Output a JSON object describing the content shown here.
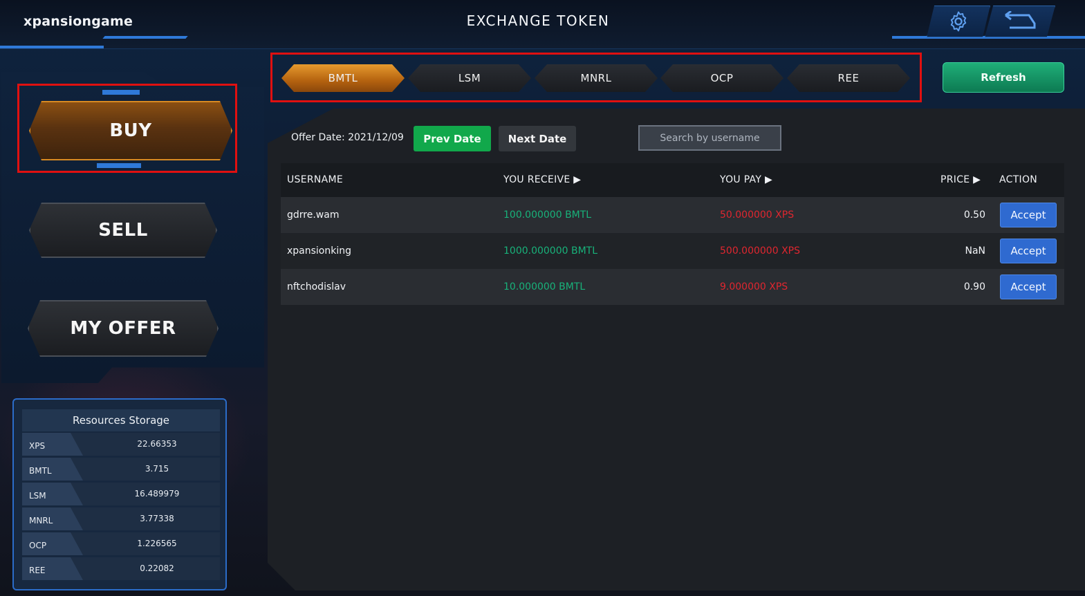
{
  "header": {
    "brand": "xpansiongame",
    "title": "EXCHANGE TOKEN",
    "settings_icon": "gear-icon",
    "back_icon": "back-arrow-icon"
  },
  "sidebar": {
    "buy_label": "BUY",
    "sell_label": "SELL",
    "my_offer_label": "MY OFFER"
  },
  "storage": {
    "title": "Resources Storage",
    "items": [
      {
        "name": "XPS",
        "value": "22.66353"
      },
      {
        "name": "BMTL",
        "value": "3.715"
      },
      {
        "name": "LSM",
        "value": "16.489979"
      },
      {
        "name": "MNRL",
        "value": "3.77338"
      },
      {
        "name": "OCP",
        "value": "1.226565"
      },
      {
        "name": "REE",
        "value": "0.22082"
      }
    ]
  },
  "tabs": [
    {
      "label": "BMTL",
      "active": true
    },
    {
      "label": "LSM",
      "active": false
    },
    {
      "label": "MNRL",
      "active": false
    },
    {
      "label": "OCP",
      "active": false
    },
    {
      "label": "REE",
      "active": false
    }
  ],
  "refresh_label": "Refresh",
  "toolbar": {
    "offer_date": "Offer Date: 2021/12/09",
    "prev_date": "Prev Date",
    "next_date": "Next Date",
    "search_placeholder": "Search by username"
  },
  "table": {
    "headers": [
      "USERNAME",
      "YOU RECEIVE ▶",
      "YOU PAY ▶",
      "PRICE ▶",
      "ACTION"
    ],
    "rows": [
      {
        "username": "gdrre.wam",
        "receive": "100.000000 BMTL",
        "pay": "50.000000 XPS",
        "price": "0.50",
        "action": "Accept"
      },
      {
        "username": "xpansionking",
        "receive": "1000.000000 BMTL",
        "pay": "500.000000 XPS",
        "price": "NaN",
        "action": "Accept"
      },
      {
        "username": "nftchodislav",
        "receive": "10.000000 BMTL",
        "pay": "9.000000 XPS",
        "price": "0.90",
        "action": "Accept"
      }
    ]
  },
  "colors": {
    "accent_orange": "#d88a22",
    "receive_green": "#18b27a",
    "pay_red": "#e0262f",
    "accept_blue": "#2f6ad0",
    "highlight_red": "#e01010"
  }
}
